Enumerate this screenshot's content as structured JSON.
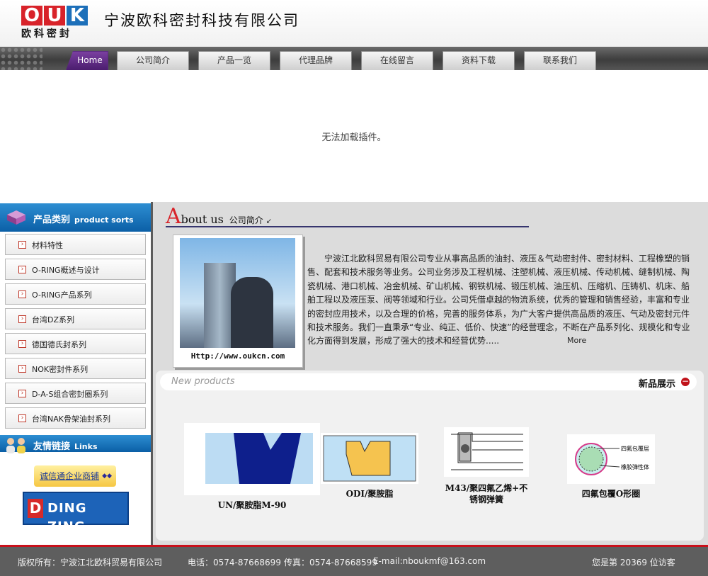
{
  "header": {
    "logo_text": "OUK",
    "logo_cn": "欧科密封",
    "company_name": "宁波欧科密封科技有限公司"
  },
  "nav": {
    "items": [
      "Home",
      "公司简介",
      "产品一览",
      "代理品牌",
      "在线留言",
      "资料下载",
      "联系我们"
    ]
  },
  "plugin": {
    "message": "无法加载插件。"
  },
  "sidebar": {
    "categories_title": "产品类别",
    "categories_title_en": "product sorts",
    "categories": [
      "材料特性",
      "O-RING概述与设计",
      "O-RING产品系列",
      "台湾DZ系列",
      "德国德氏封系列",
      "NOK密封件系列",
      "D-A-S组合密封圈系列",
      "台湾NAK骨架油封系列"
    ],
    "links_title": "友情链接",
    "links_title_en": "Links",
    "links": [
      "诚信通企业商铺",
      "DING ZING"
    ]
  },
  "about": {
    "title_initial": "A",
    "title_rest": "bout us",
    "title_cn": "公司简介",
    "photo_url_text": "Http://www.oukcn.com",
    "text": "宁波江北欧科贸易有限公司专业从事高品质的油封、液压＆气动密封件、密封材料、工程橡塑的销售、配套和技术服务等业务。公司业务涉及工程机械、注塑机械、液压机械、传动机械、缝制机械、陶瓷机械、港口机械、冶金机械、矿山机械、钢铁机械、锻压机械、油压机、压缩机、压铸机、机床、船舶工程以及液压泵、阀等领域和行业。公司凭借卓越的物流系统，优秀的管理和销售经验，丰富和专业的密封应用技术，以及合理的价格，完善的服务体系，为广大客户提供高品质的液压、气动及密封元件和技术服务。我们一直秉承“专业、纯正、低价、快速”的经营理念，不断在产品系列化、规模化和专业化方面得到发展，形成了强大的技术和经营优势.....",
    "more": "More"
  },
  "new_products": {
    "title_en": "New products",
    "title_cn": "新品展示",
    "items": [
      {
        "name": "UN/聚胺脂M-90"
      },
      {
        "name": "ODI/聚胺脂"
      },
      {
        "name": "M43/聚四氟乙烯+不锈钢弹簧"
      },
      {
        "name": "四氟包覆O形圈"
      }
    ],
    "diagram_labels": [
      "四氟包覆层",
      "橡胶弹性体"
    ]
  },
  "footer": {
    "copyright": "版权所有：宁波江北欧科贸易有限公司",
    "phone": "电话：0574-87668699",
    "fax": "传真：0574-87668599",
    "email": "E-mail:nboukmf@163.com",
    "visitors": "您是第 20369 位访客"
  },
  "colors": {
    "accent_red": "#d8232a",
    "nav_dark": "#3d3d3d",
    "sidebar_blue": "#0b5fa6",
    "footer_gray": "#5e5e5e",
    "home_purple": "#5a2a80"
  }
}
